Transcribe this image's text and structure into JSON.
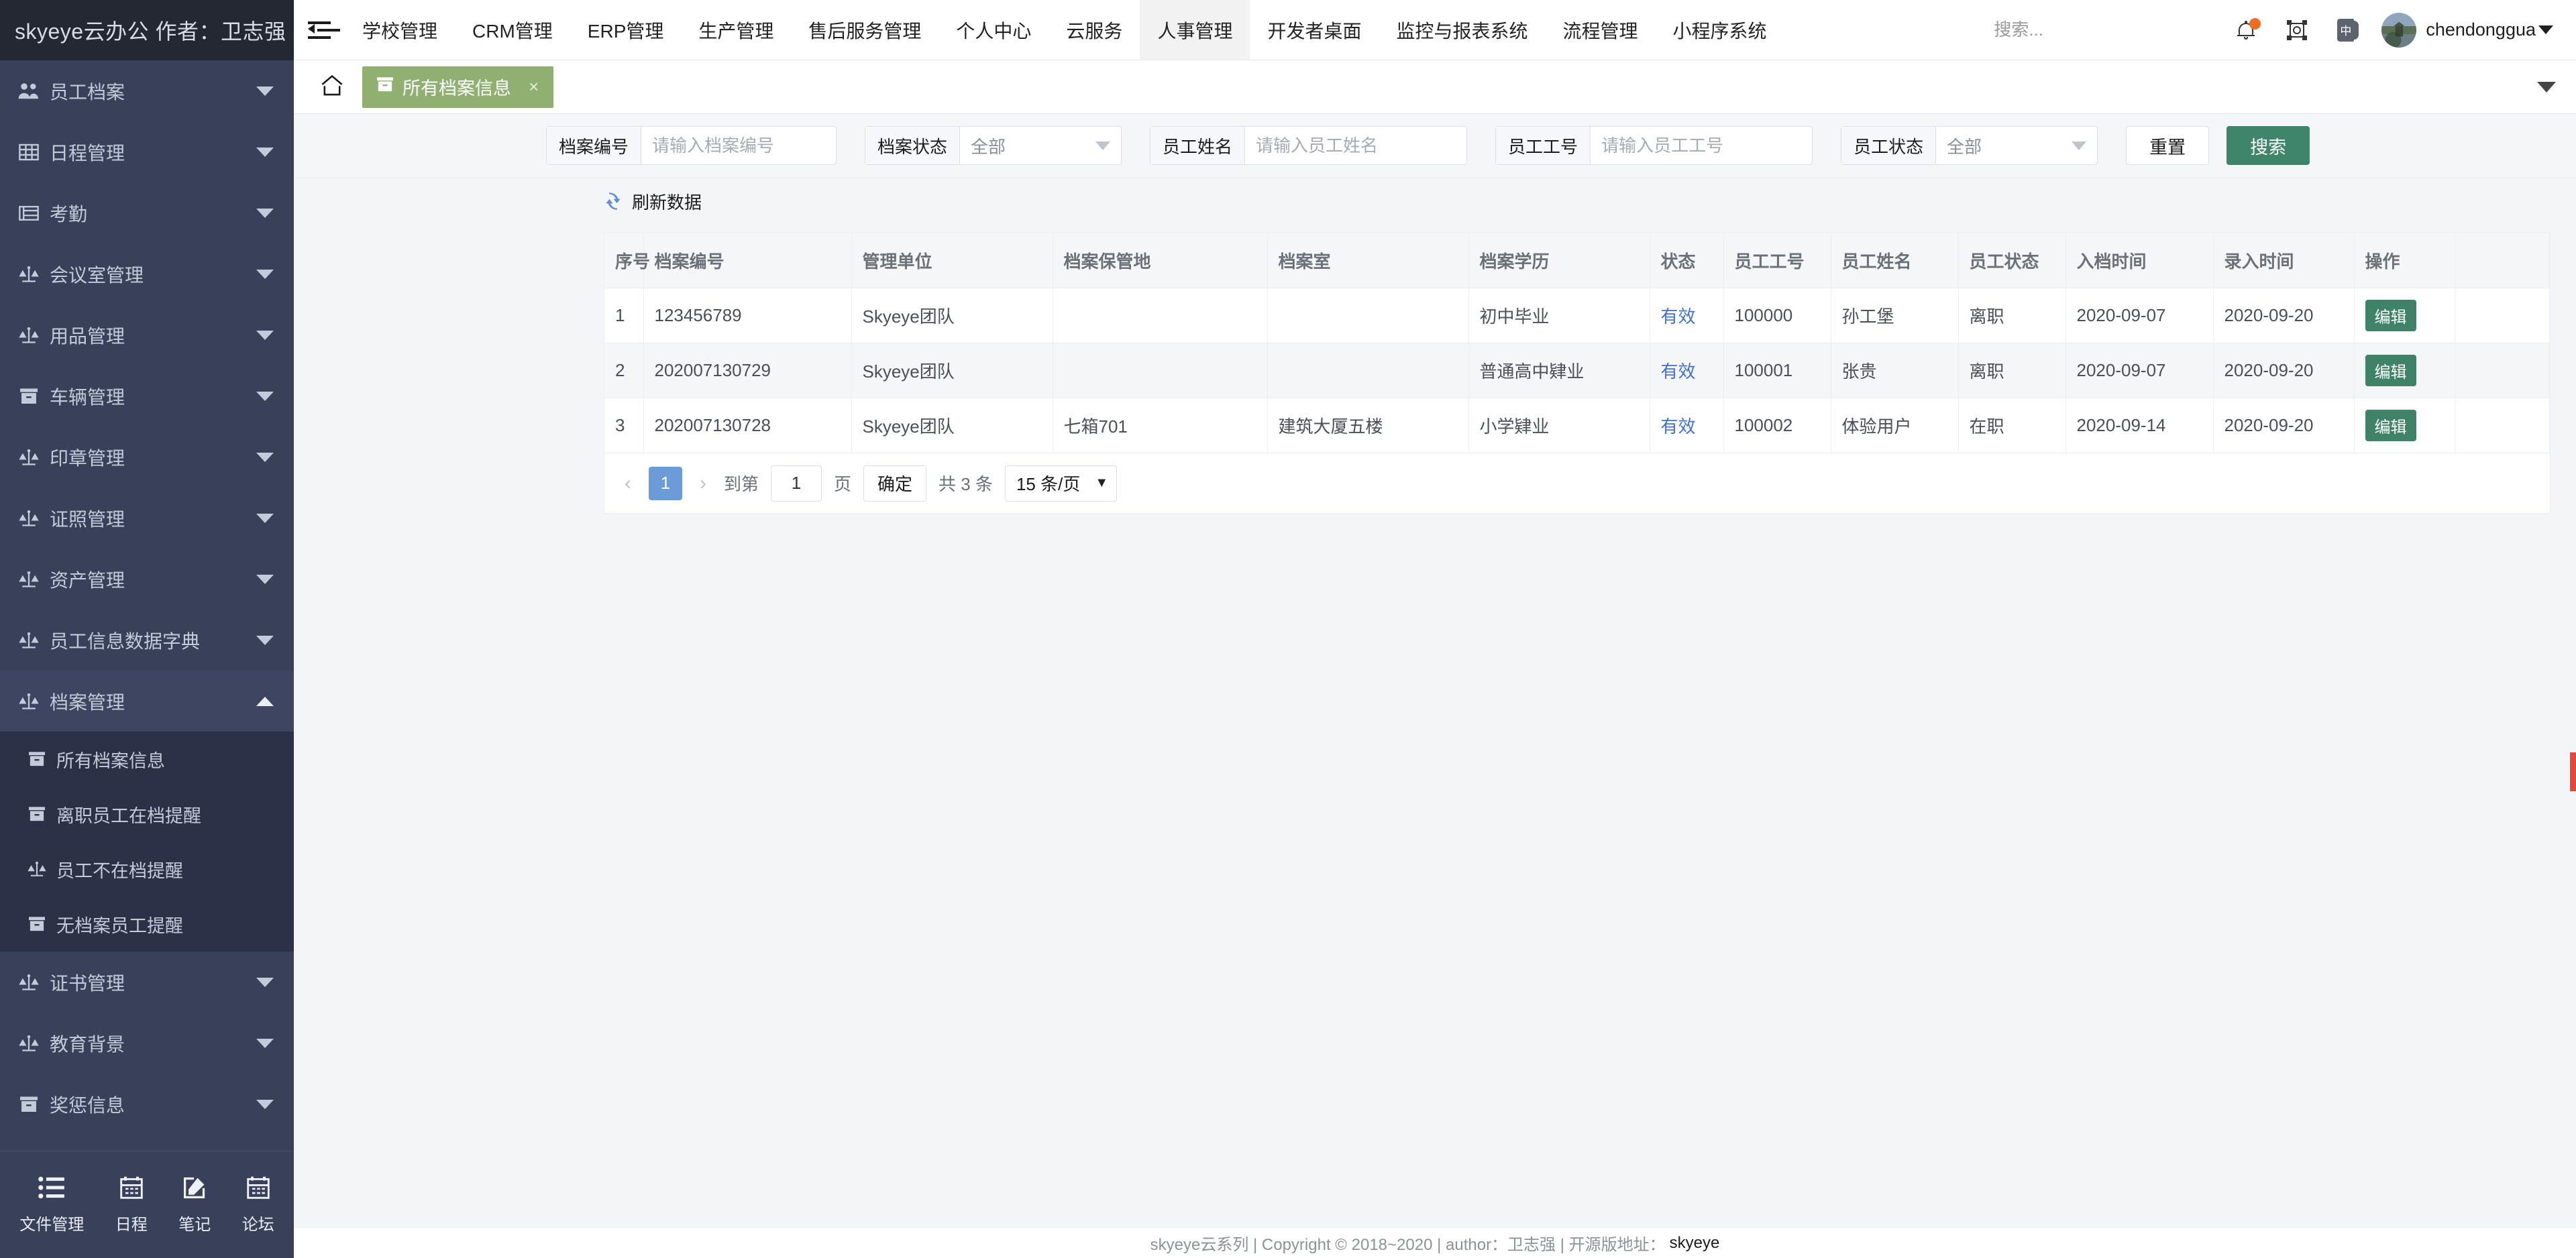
{
  "brand": {
    "title": "skyeye云办公 作者：卫志强"
  },
  "topnav": {
    "collapse_icon": "indent-menu-icon",
    "items": [
      {
        "label": "学校管理",
        "active": false
      },
      {
        "label": "CRM管理",
        "active": false
      },
      {
        "label": "ERP管理",
        "active": false
      },
      {
        "label": "生产管理",
        "active": false
      },
      {
        "label": "售后服务管理",
        "active": false
      },
      {
        "label": "个人中心",
        "active": false
      },
      {
        "label": "云服务",
        "active": false
      },
      {
        "label": "人事管理",
        "active": true
      },
      {
        "label": "开发者桌面",
        "active": false
      },
      {
        "label": "监控与报表系统",
        "active": false
      },
      {
        "label": "流程管理",
        "active": false
      },
      {
        "label": "小程序系统",
        "active": false
      }
    ],
    "search": {
      "placeholder": "搜索...",
      "value": ""
    },
    "icons": [
      "bell-icon",
      "fullscreen-icon",
      "language-icon"
    ],
    "notification_dot_color": "#f56a21",
    "user": {
      "name": "chendonggua",
      "avatar": "user-avatar"
    }
  },
  "sidebar": {
    "items": [
      {
        "label": "员工档案",
        "icon": "users-icon",
        "expanded": false
      },
      {
        "label": "日程管理",
        "icon": "grid-icon",
        "expanded": false
      },
      {
        "label": "考勤",
        "icon": "box-icon",
        "expanded": false
      },
      {
        "label": "会议室管理",
        "icon": "scales-icon",
        "expanded": false
      },
      {
        "label": "用品管理",
        "icon": "scales-icon",
        "expanded": false
      },
      {
        "label": "车辆管理",
        "icon": "archive-icon",
        "expanded": false
      },
      {
        "label": "印章管理",
        "icon": "scales-icon",
        "expanded": false
      },
      {
        "label": "证照管理",
        "icon": "scales-icon",
        "expanded": false
      },
      {
        "label": "资产管理",
        "icon": "scales-icon",
        "expanded": false
      },
      {
        "label": "员工信息数据字典",
        "icon": "scales-icon",
        "expanded": false
      },
      {
        "label": "档案管理",
        "icon": "scales-icon",
        "expanded": true
      },
      {
        "label": "证书管理",
        "icon": "scales-icon",
        "expanded": false
      },
      {
        "label": "教育背景",
        "icon": "scales-icon",
        "expanded": false
      },
      {
        "label": "奖惩信息",
        "icon": "archive-icon",
        "expanded": false
      }
    ],
    "submenu": [
      {
        "label": "所有档案信息",
        "icon": "archive-icon",
        "active": true
      },
      {
        "label": "离职员工在档提醒",
        "icon": "archive-icon",
        "active": false
      },
      {
        "label": "员工不在档提醒",
        "icon": "scales-icon",
        "active": false
      },
      {
        "label": "无档案员工提醒",
        "icon": "archive-icon",
        "active": false
      }
    ],
    "bottom": [
      {
        "label": "文件管理",
        "icon": "list-icon"
      },
      {
        "label": "日程",
        "icon": "calendar-icon"
      },
      {
        "label": "笔记",
        "icon": "pencil-square-icon"
      },
      {
        "label": "论坛",
        "icon": "calendar-icon"
      }
    ]
  },
  "tabbar": {
    "home_icon": "home-icon",
    "tabs": [
      {
        "label": "所有档案信息",
        "icon": "archive-icon",
        "active": true,
        "close": "×"
      }
    ],
    "dropdown_icon": "chevron-down-icon"
  },
  "search_form": {
    "fields": [
      {
        "label": "档案编号",
        "type": "input",
        "placeholder": "请输入档案编号",
        "value": ""
      },
      {
        "label": "档案状态",
        "type": "select",
        "value": "全部"
      },
      {
        "label": "员工姓名",
        "type": "input",
        "placeholder": "请输入员工姓名",
        "value": ""
      },
      {
        "label": "员工工号",
        "type": "input",
        "placeholder": "请输入员工工号",
        "value": ""
      },
      {
        "label": "员工状态",
        "type": "select",
        "value": "全部"
      }
    ],
    "reset_label": "重置",
    "search_label": "搜索",
    "primary_color": "#3e856b"
  },
  "toolbar": {
    "refresh_label": "刷新数据",
    "refresh_icon": "refresh-icon"
  },
  "table": {
    "columns": [
      "序号",
      "档案编号",
      "管理单位",
      "档案保管地",
      "档案室",
      "档案学历",
      "状态",
      "员工工号",
      "员工姓名",
      "员工状态",
      "入档时间",
      "录入时间",
      "操作",
      ""
    ],
    "rows": [
      {
        "seq": "1",
        "code": "123456789",
        "unit": "Skyeye团队",
        "keep_place": "",
        "room": "",
        "education": "初中毕业",
        "status": "有效",
        "emp_no": "100000",
        "emp_name": "孙工堡",
        "emp_status": "离职",
        "file_date": "2020-09-07",
        "entry_date": "2020-09-20",
        "action": "编辑"
      },
      {
        "seq": "2",
        "code": "202007130729",
        "unit": "Skyeye团队",
        "keep_place": "",
        "room": "",
        "education": "普通高中肄业",
        "status": "有效",
        "emp_no": "100001",
        "emp_name": "张贵",
        "emp_status": "离职",
        "file_date": "2020-09-07",
        "entry_date": "2020-09-20",
        "action": "编辑"
      },
      {
        "seq": "3",
        "code": "202007130728",
        "unit": "Skyeye团队",
        "keep_place": "七箱701",
        "room": "建筑大厦五楼",
        "education": "小学肄业",
        "status": "有效",
        "emp_no": "100002",
        "emp_name": "体验用户",
        "emp_status": "在职",
        "file_date": "2020-09-14",
        "entry_date": "2020-09-20",
        "action": "编辑"
      }
    ],
    "status_color": "#3f6fd8",
    "edit_button_color": "#3e8268"
  },
  "pagination": {
    "prev": "‹",
    "current_page": "1",
    "next": "›",
    "goto_label": "到第",
    "goto_value": "1",
    "page_unit": "页",
    "confirm_label": "确定",
    "total_label": "共 3 条",
    "page_size": "15 条/页",
    "caret": "▼"
  },
  "footer": {
    "text": "skyeye云系列 | Copyright © 2018~2020 | author：卫志强 | 开源版地址：",
    "link": "skyeye"
  }
}
